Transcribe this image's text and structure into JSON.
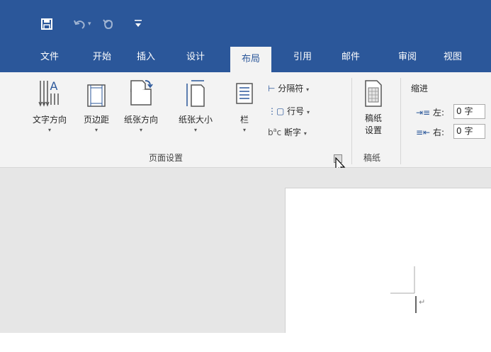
{
  "qat": {
    "save_icon": "save-icon",
    "undo_icon": "undo-icon",
    "redo_icon": "redo-icon",
    "customize_icon": "customize-qat-icon"
  },
  "tabs": {
    "file": "文件",
    "home": "开始",
    "insert": "插入",
    "design": "设计",
    "layout": "布局",
    "references": "引用",
    "mailings": "邮件",
    "review": "审阅",
    "view": "视图"
  },
  "page_setup": {
    "text_direction": "文字方向",
    "margins": "页边距",
    "orientation": "纸张方向",
    "size": "纸张大小",
    "columns": "栏",
    "breaks": "分隔符",
    "line_numbers": "行号",
    "hyphenation": "断字",
    "group_label": "页面设置"
  },
  "manuscript": {
    "button_line1": "稿纸",
    "button_line2": "设置",
    "group_label": "稿纸"
  },
  "indent": {
    "heading": "缩进",
    "left_label": "左:",
    "left_value": "0 字",
    "right_label": "右:",
    "right_value": "0 字"
  },
  "colors": {
    "accent": "#2b579a",
    "ribbon_bg": "#f3f3f3",
    "workspace_bg": "#e6e6e6"
  }
}
